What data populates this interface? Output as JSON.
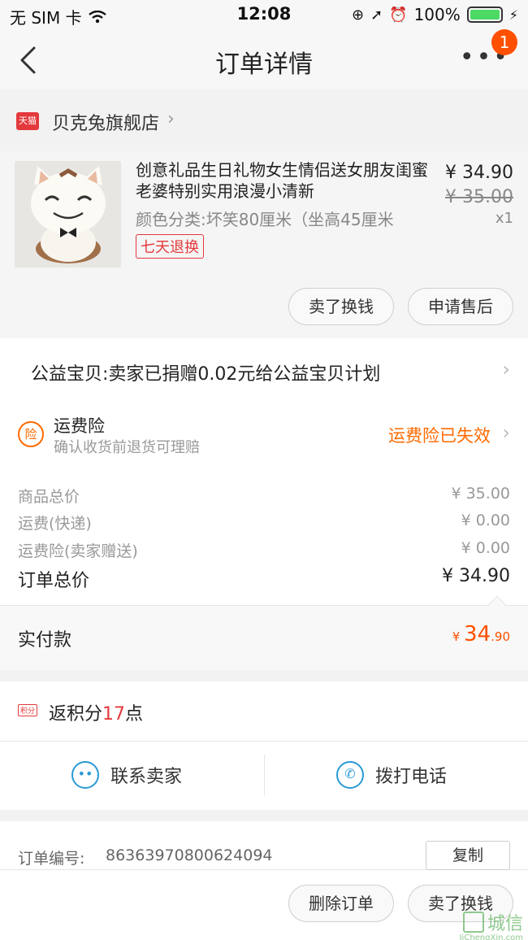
{
  "status_bar": {
    "carrier": "无 SIM 卡",
    "time": "12:08",
    "battery": "100%"
  },
  "nav": {
    "title": "订单详情",
    "badge": "1"
  },
  "store": {
    "logo": "天猫",
    "name": "贝克兔旗舰店"
  },
  "product": {
    "title": "创意礼品生日礼物女生情侣送女朋友闺蜜老婆特别实用浪漫小清新",
    "sku": "颜色分类:坏笑80厘米（坐高45厘米",
    "tag": "七天退换",
    "price": "¥ 34.90",
    "original_price": "¥ 35.00",
    "qty": "x1",
    "btn_sell": "卖了换钱",
    "btn_after_sale": "申请售后"
  },
  "charity": {
    "text": "公益宝贝:卖家已捐赠0.02元给公益宝贝计划"
  },
  "insurance": {
    "icon": "险",
    "title": "运费险",
    "subtitle": "确认收货前退货可理赔",
    "status": "运费险已失效"
  },
  "prices": {
    "items": [
      {
        "label": "商品总价",
        "value": "¥ 35.00"
      },
      {
        "label": "运费(快递)",
        "value": "¥ 0.00"
      },
      {
        "label": "运费险(卖家赠送)",
        "value": "¥ 0.00"
      }
    ],
    "total_label": "订单总价",
    "total_value": "¥ 34.90",
    "paid_label": "实付款",
    "paid_currency": "¥",
    "paid_int": "34",
    "paid_dec": ".90"
  },
  "points": {
    "icon": "积分",
    "prefix": "返积分",
    "num": "17",
    "suffix": "点"
  },
  "contact": {
    "seller": "联系卖家",
    "phone": "拨打电话"
  },
  "order": {
    "label": "订单编号:",
    "number": "86363970800624094",
    "copy": "复制"
  },
  "bottom": {
    "delete": "删除订单",
    "sell": "卖了换钱"
  },
  "watermark": {
    "text": "城信",
    "url": "JiChengXin.com"
  }
}
